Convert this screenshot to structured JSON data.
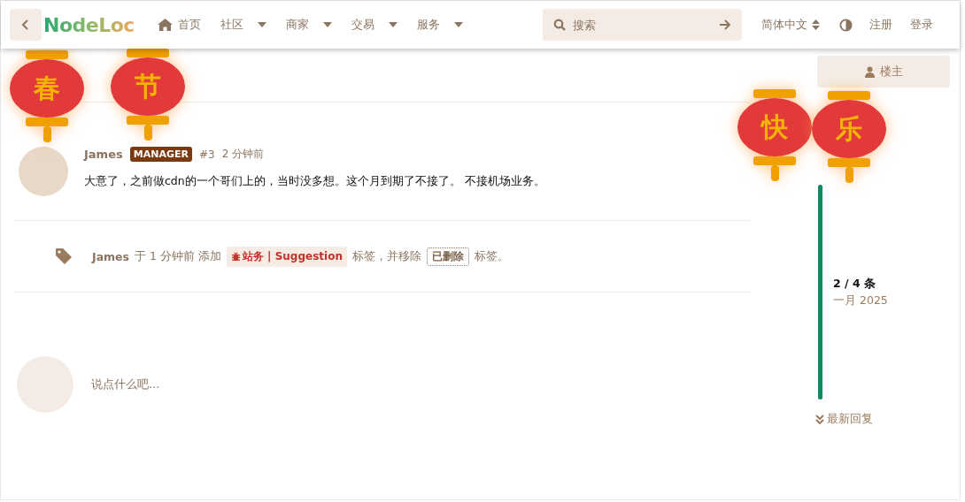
{
  "header": {
    "logo": "NodeLoc",
    "nav": [
      {
        "label": "首页",
        "kind": "home"
      },
      {
        "label": "社区",
        "kind": "menu"
      },
      {
        "label": "商家",
        "kind": "menu"
      },
      {
        "label": "交易",
        "kind": "menu"
      },
      {
        "label": "服务",
        "kind": "menu"
      }
    ],
    "search": {
      "placeholder": "搜索"
    },
    "language": "简体中文",
    "actions": [
      "注册",
      "登录"
    ]
  },
  "lanterns": [
    "春",
    "节",
    "快",
    "乐"
  ],
  "post": {
    "author": "James",
    "badge": "MANAGER",
    "number": "#3",
    "time": "2 分钟前",
    "body": "大意了，之前做cdn的一个哥们上的，当时没多想。这个月到期了不接了。 不接机场业务。"
  },
  "event": {
    "author": "James",
    "action": "于 1 分钟前 添加",
    "added_tag": "站务 | Suggestion",
    "middle": "标签，并移除",
    "removed_tag": "已删除",
    "end": "标签。"
  },
  "composer": {
    "placeholder": "说点什么吧..."
  },
  "sidebar": {
    "op_button": "楼主",
    "scrubber": {
      "position": "2 / 4 条",
      "date": "一月 2025",
      "level": 1
    },
    "latest": "最新回复"
  }
}
